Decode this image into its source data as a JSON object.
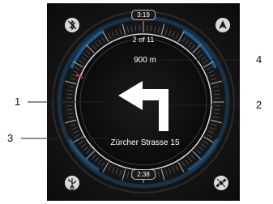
{
  "navigation": {
    "time_to_turn": "3:19",
    "turn_progress": "2 of 11",
    "distance": "900 m",
    "street": "Zürcher Strasse 15",
    "time_bottom": "2:38",
    "maneuver_icon": "turn-left-arrow-icon"
  },
  "icons": {
    "top_left": "bluetooth-off-icon",
    "top_right": "compass-arrow-icon",
    "bottom_left": "usb-icon",
    "bottom_right": "satellite-icon"
  },
  "callouts": [
    "1",
    "2",
    "3",
    "4"
  ],
  "colors": {
    "background": "#161616",
    "ring_accent": "#1f6aa5",
    "marker_red": "#d93a3a",
    "text": "#ffffff"
  }
}
